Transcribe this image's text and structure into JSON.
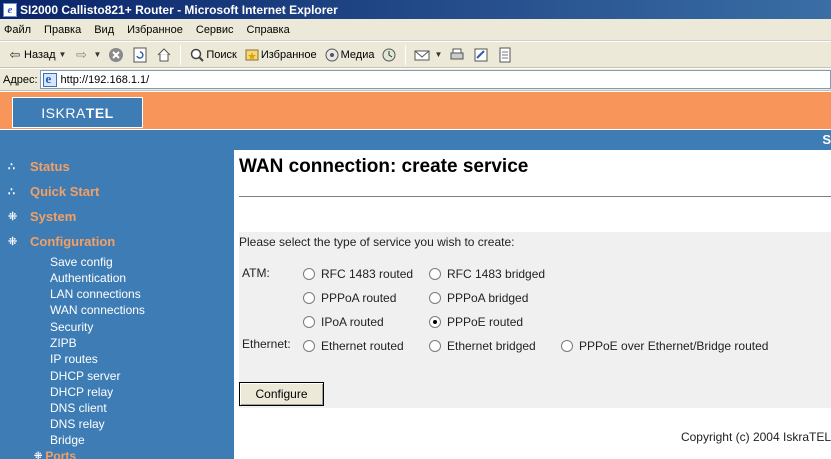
{
  "window": {
    "title": "SI2000 Callisto821+ Router - Microsoft Internet Explorer"
  },
  "menu": [
    "Файл",
    "Правка",
    "Вид",
    "Избранное",
    "Сервис",
    "Справка"
  ],
  "toolbar": {
    "back": "Назад",
    "search": "Поиск",
    "favorites": "Избранное",
    "media": "Медиа"
  },
  "address": {
    "label": "Адрес:",
    "url": "http://192.168.1.1/"
  },
  "header": {
    "logo_left": "ISKRA",
    "logo_right": "TEL",
    "edge_text": "S"
  },
  "sidebar": {
    "main": [
      "Status",
      "Quick Start",
      "System",
      "Configuration"
    ],
    "sub": [
      "Save config",
      "Authentication",
      "LAN connections",
      "WAN connections",
      "Security",
      "ZIPB",
      "IP routes",
      "DHCP server",
      "DHCP relay",
      "DNS client",
      "DNS relay",
      "Bridge"
    ],
    "ports": "Ports"
  },
  "content": {
    "title": "WAN connection: create service",
    "instruction": "Please select the type of service you wish to create:",
    "atm_label": "ATM:",
    "ethernet_label": "Ethernet:",
    "options": {
      "rfc1483_routed": "RFC 1483 routed",
      "rfc1483_bridged": "RFC 1483 bridged",
      "pppoa_routed": "PPPoA routed",
      "pppoa_bridged": "PPPoA bridged",
      "ipoa_routed": "IPoA routed",
      "pppoe_routed": "PPPoE routed",
      "ethernet_routed": "Ethernet routed",
      "ethernet_bridged": "Ethernet bridged",
      "pppoe_over_ethernet": "PPPoE over Ethernet/Bridge routed"
    },
    "selected": "pppoe_routed",
    "configure_button": "Configure",
    "copyright": "Copyright (c) 2004 IskraTEL"
  },
  "colors": {
    "orange": "#f7955b",
    "blue": "#3e7cb5",
    "nav_text": "#f2a065"
  }
}
